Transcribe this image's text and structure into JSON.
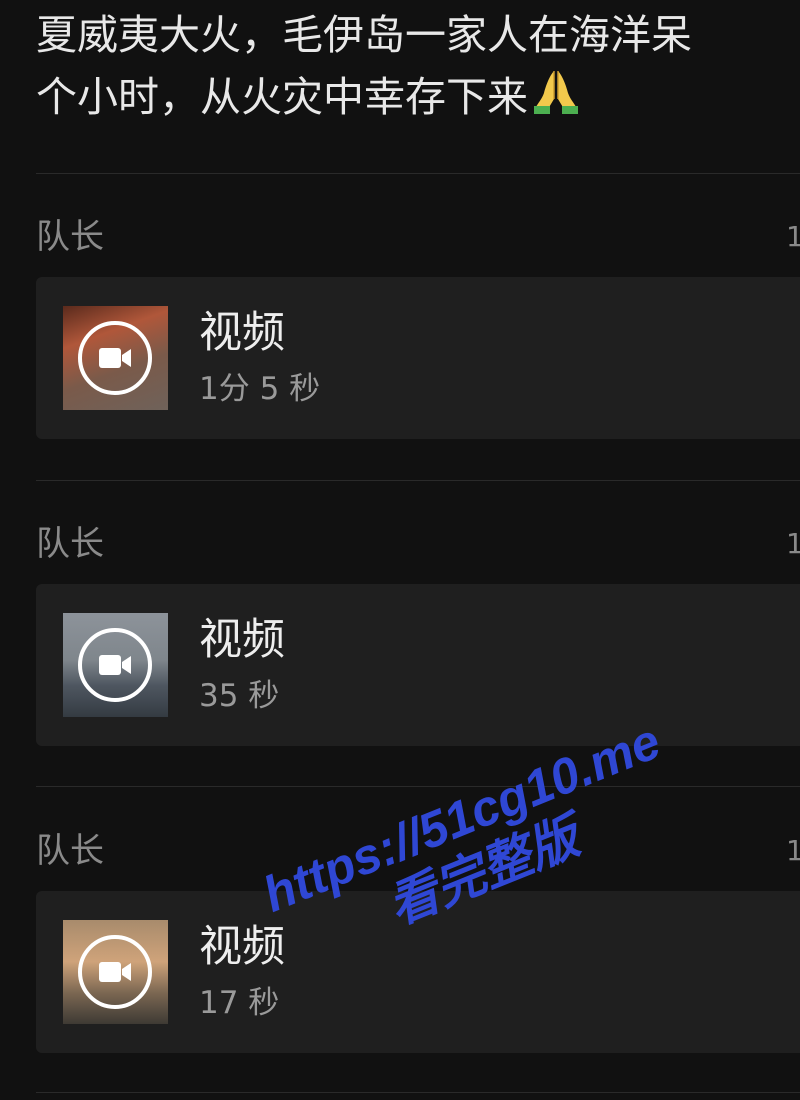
{
  "post": {
    "title_line1": "夏威夷大火，毛伊岛一家人在海洋呆",
    "title_line2": "个小时，从火灾中幸存下来"
  },
  "messages": [
    {
      "author": "队长",
      "meta": "1",
      "label": "视频",
      "duration": "1分 5 秒"
    },
    {
      "author": "队长",
      "meta": "1",
      "label": "视频",
      "duration": "35 秒"
    },
    {
      "author": "队长",
      "meta": "1",
      "label": "视频",
      "duration": "17 秒"
    }
  ],
  "watermark": {
    "url": "https://51cg10.me",
    "cta": "看完整版"
  },
  "icons": [
    "folded-hands-emoji",
    "video-camera-icon"
  ],
  "colors": {
    "background": "#111111",
    "card": "#1f1f1f",
    "watermark": "#2f47d4"
  }
}
